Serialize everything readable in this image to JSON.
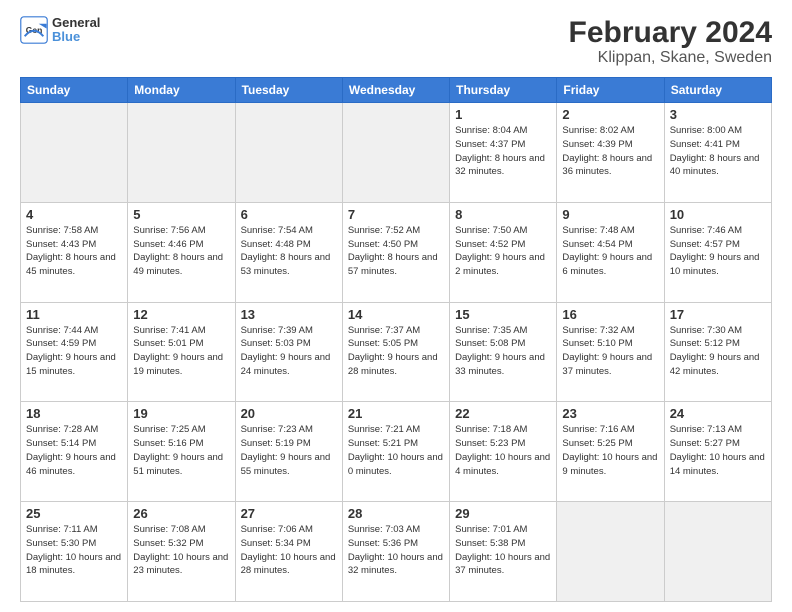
{
  "header": {
    "logo_line1": "General",
    "logo_line2": "Blue",
    "title": "February 2024",
    "subtitle": "Klippan, Skane, Sweden"
  },
  "days_of_week": [
    "Sunday",
    "Monday",
    "Tuesday",
    "Wednesday",
    "Thursday",
    "Friday",
    "Saturday"
  ],
  "weeks": [
    [
      {
        "day": "",
        "info": "",
        "empty": true
      },
      {
        "day": "",
        "info": "",
        "empty": true
      },
      {
        "day": "",
        "info": "",
        "empty": true
      },
      {
        "day": "",
        "info": "",
        "empty": true
      },
      {
        "day": "1",
        "info": "Sunrise: 8:04 AM\nSunset: 4:37 PM\nDaylight: 8 hours\nand 32 minutes."
      },
      {
        "day": "2",
        "info": "Sunrise: 8:02 AM\nSunset: 4:39 PM\nDaylight: 8 hours\nand 36 minutes."
      },
      {
        "day": "3",
        "info": "Sunrise: 8:00 AM\nSunset: 4:41 PM\nDaylight: 8 hours\nand 40 minutes."
      }
    ],
    [
      {
        "day": "4",
        "info": "Sunrise: 7:58 AM\nSunset: 4:43 PM\nDaylight: 8 hours\nand 45 minutes."
      },
      {
        "day": "5",
        "info": "Sunrise: 7:56 AM\nSunset: 4:46 PM\nDaylight: 8 hours\nand 49 minutes."
      },
      {
        "day": "6",
        "info": "Sunrise: 7:54 AM\nSunset: 4:48 PM\nDaylight: 8 hours\nand 53 minutes."
      },
      {
        "day": "7",
        "info": "Sunrise: 7:52 AM\nSunset: 4:50 PM\nDaylight: 8 hours\nand 57 minutes."
      },
      {
        "day": "8",
        "info": "Sunrise: 7:50 AM\nSunset: 4:52 PM\nDaylight: 9 hours\nand 2 minutes."
      },
      {
        "day": "9",
        "info": "Sunrise: 7:48 AM\nSunset: 4:54 PM\nDaylight: 9 hours\nand 6 minutes."
      },
      {
        "day": "10",
        "info": "Sunrise: 7:46 AM\nSunset: 4:57 PM\nDaylight: 9 hours\nand 10 minutes."
      }
    ],
    [
      {
        "day": "11",
        "info": "Sunrise: 7:44 AM\nSunset: 4:59 PM\nDaylight: 9 hours\nand 15 minutes."
      },
      {
        "day": "12",
        "info": "Sunrise: 7:41 AM\nSunset: 5:01 PM\nDaylight: 9 hours\nand 19 minutes."
      },
      {
        "day": "13",
        "info": "Sunrise: 7:39 AM\nSunset: 5:03 PM\nDaylight: 9 hours\nand 24 minutes."
      },
      {
        "day": "14",
        "info": "Sunrise: 7:37 AM\nSunset: 5:05 PM\nDaylight: 9 hours\nand 28 minutes."
      },
      {
        "day": "15",
        "info": "Sunrise: 7:35 AM\nSunset: 5:08 PM\nDaylight: 9 hours\nand 33 minutes."
      },
      {
        "day": "16",
        "info": "Sunrise: 7:32 AM\nSunset: 5:10 PM\nDaylight: 9 hours\nand 37 minutes."
      },
      {
        "day": "17",
        "info": "Sunrise: 7:30 AM\nSunset: 5:12 PM\nDaylight: 9 hours\nand 42 minutes."
      }
    ],
    [
      {
        "day": "18",
        "info": "Sunrise: 7:28 AM\nSunset: 5:14 PM\nDaylight: 9 hours\nand 46 minutes."
      },
      {
        "day": "19",
        "info": "Sunrise: 7:25 AM\nSunset: 5:16 PM\nDaylight: 9 hours\nand 51 minutes."
      },
      {
        "day": "20",
        "info": "Sunrise: 7:23 AM\nSunset: 5:19 PM\nDaylight: 9 hours\nand 55 minutes."
      },
      {
        "day": "21",
        "info": "Sunrise: 7:21 AM\nSunset: 5:21 PM\nDaylight: 10 hours\nand 0 minutes."
      },
      {
        "day": "22",
        "info": "Sunrise: 7:18 AM\nSunset: 5:23 PM\nDaylight: 10 hours\nand 4 minutes."
      },
      {
        "day": "23",
        "info": "Sunrise: 7:16 AM\nSunset: 5:25 PM\nDaylight: 10 hours\nand 9 minutes."
      },
      {
        "day": "24",
        "info": "Sunrise: 7:13 AM\nSunset: 5:27 PM\nDaylight: 10 hours\nand 14 minutes."
      }
    ],
    [
      {
        "day": "25",
        "info": "Sunrise: 7:11 AM\nSunset: 5:30 PM\nDaylight: 10 hours\nand 18 minutes."
      },
      {
        "day": "26",
        "info": "Sunrise: 7:08 AM\nSunset: 5:32 PM\nDaylight: 10 hours\nand 23 minutes."
      },
      {
        "day": "27",
        "info": "Sunrise: 7:06 AM\nSunset: 5:34 PM\nDaylight: 10 hours\nand 28 minutes."
      },
      {
        "day": "28",
        "info": "Sunrise: 7:03 AM\nSunset: 5:36 PM\nDaylight: 10 hours\nand 32 minutes."
      },
      {
        "day": "29",
        "info": "Sunrise: 7:01 AM\nSunset: 5:38 PM\nDaylight: 10 hours\nand 37 minutes."
      },
      {
        "day": "",
        "info": "",
        "empty": true
      },
      {
        "day": "",
        "info": "",
        "empty": true
      }
    ]
  ]
}
